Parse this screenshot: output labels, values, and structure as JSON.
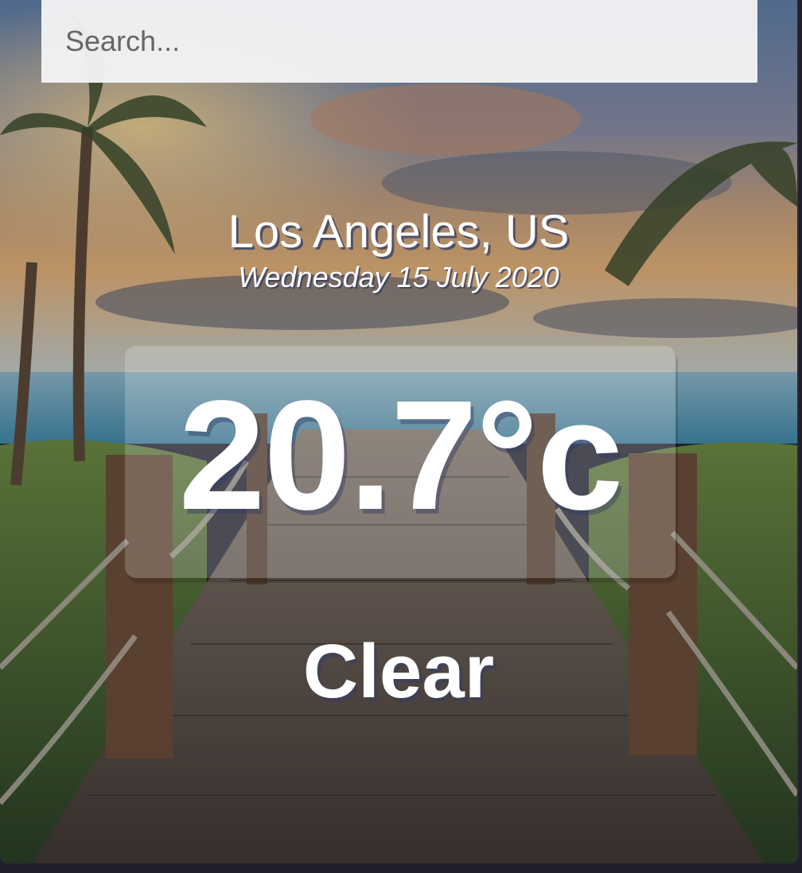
{
  "search": {
    "placeholder": "Search...",
    "value": ""
  },
  "location": {
    "city_country": "Los Angeles, US",
    "date": "Wednesday 15 July 2020"
  },
  "weather": {
    "temperature": "20.7°c",
    "condition": "Clear"
  },
  "background": {
    "description_icon": "beach-boardwalk-background",
    "colors": {
      "sky_top": "#6f8fb0",
      "sunset": "#f0a45a",
      "sea": "#5fa8c0",
      "boardwalk": "#6b5a4a",
      "foliage": "#3e6a2a"
    }
  }
}
